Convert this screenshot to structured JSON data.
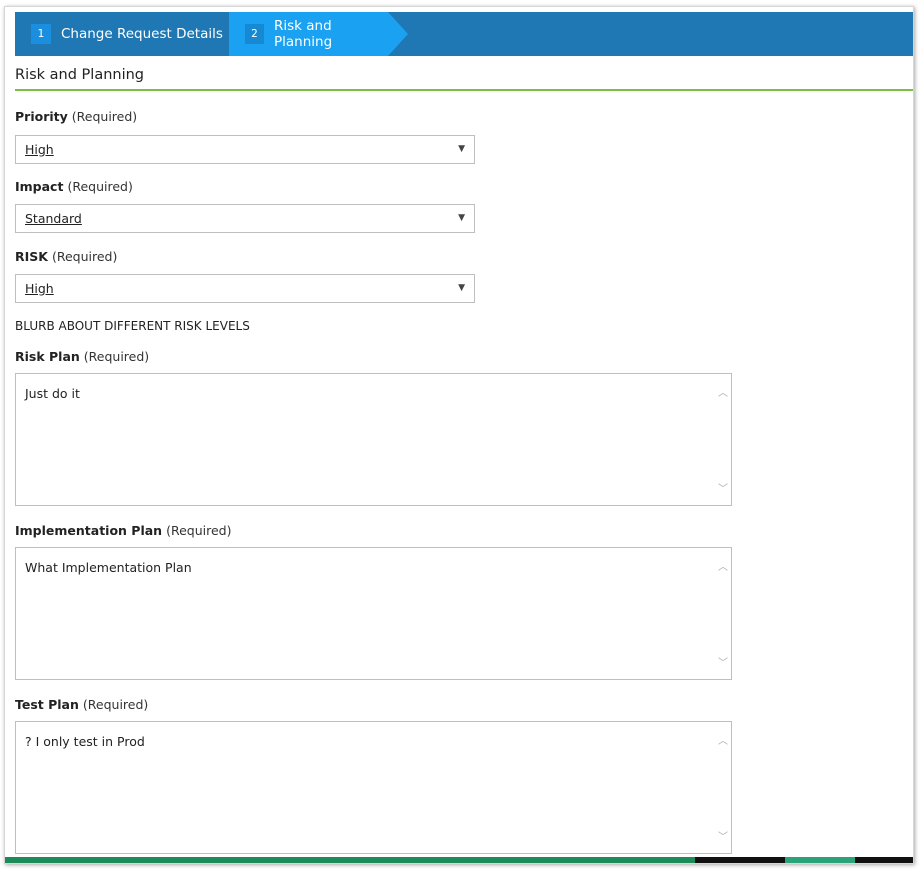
{
  "wizard": {
    "steps": [
      {
        "number": "1",
        "label": "Change Request Details"
      },
      {
        "number": "2",
        "label": "Risk and Planning"
      }
    ]
  },
  "section": {
    "title": "Risk and Planning"
  },
  "fields": {
    "priority": {
      "label": "Priority",
      "required": "(Required)",
      "value": "High"
    },
    "impact": {
      "label": "Impact",
      "required": "(Required)",
      "value": "Standard"
    },
    "risk": {
      "label": "RISK",
      "required": "(Required)",
      "value": "High"
    },
    "risk_note": "BLURB ABOUT DIFFERENT RISK LEVELS",
    "risk_plan": {
      "label": "Risk Plan",
      "required": "(Required)",
      "value": "Just do it"
    },
    "implementation_plan": {
      "label": "Implementation Plan",
      "required": "(Required)",
      "value": "What Implementation Plan"
    },
    "test_plan": {
      "label": "Test Plan",
      "required": "(Required)",
      "value": "? I only test in Prod"
    }
  },
  "colors": {
    "wizard_bg": "#1f77b4",
    "active_step": "#1ba1f2",
    "section_underline": "#7ac043"
  }
}
